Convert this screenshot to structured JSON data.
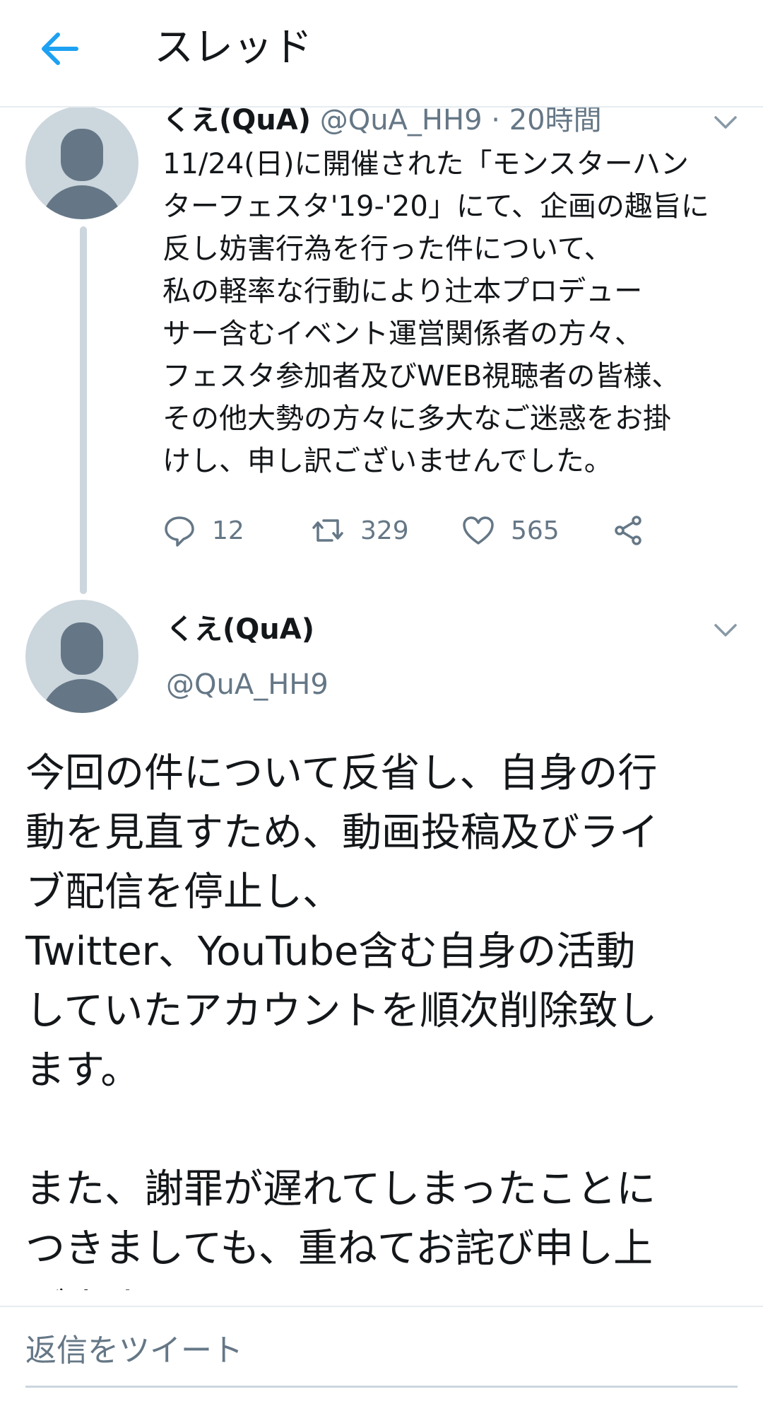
{
  "header": {
    "title": "スレッド"
  },
  "tweet1": {
    "name": "くえ(QuA)",
    "handle": "@QuA_HH9",
    "separator": " · ",
    "time": "20時間",
    "text": "11/24(日)に開催された「モンスターハン\nターフェスタ'19-'20」にて、企画の趣旨に\n反し妨害行為を行った件について、\n私の軽率な行動により辻本プロデュー\nサー含むイベント運営関係者の方々、\nフェスタ参加者及びWEB視聴者の皆様、\nその他大勢の方々に多大なご迷惑をお掛\nけし、申し訳ございませんでした。",
    "stats": {
      "replies": "12",
      "retweets": "329",
      "likes": "565"
    }
  },
  "tweet2": {
    "name": "くえ(QuA)",
    "handle": "@QuA_HH9",
    "text": "今回の件について反省し、自身の行\n動を見直すため、動画投稿及びライ\nブ配信を停止し、\nTwitter、YouTube含む自身の活動\nしていたアカウントを順次削除致し\nます。\n\nまた、謝罪が遅れてしまったことに\nつきましても、重ねてお詫び申し上\nげます。"
  },
  "reply": {
    "placeholder": "返信をツイート"
  },
  "icons": {
    "back": "arrow-left-icon",
    "reply": "speech-bubble-icon",
    "retweet": "retweet-icon",
    "like": "heart-icon",
    "share": "share-icon",
    "more": "chevron-down-icon"
  },
  "colors": {
    "accent": "#1da1f2",
    "muted": "#657786",
    "line": "#ccd6dd"
  }
}
